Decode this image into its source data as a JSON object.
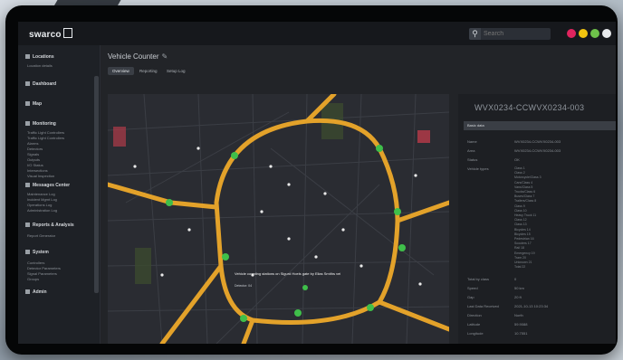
{
  "app": {
    "logo_text": "swarco",
    "search_placeholder": "Search"
  },
  "window_controls": {
    "colors": [
      "#e0245e",
      "#f1c40f",
      "#6ec24a",
      "#e8eaed"
    ]
  },
  "sidebar": {
    "sections": [
      {
        "label": "Locations",
        "items": [
          "Location details"
        ]
      },
      {
        "label": "Dashboard",
        "items": []
      },
      {
        "label": "Map",
        "items": []
      },
      {
        "label": "Monitoring",
        "items": [
          "Traffic Light Controllers",
          "Traffic Light Controllers",
          "Alarms",
          "Detectors",
          "Signals",
          "Outputs",
          "I/O Status",
          "Intersections",
          "Visual Inspection"
        ]
      },
      {
        "label": "Messages Center",
        "items": [
          "Maintenance Log",
          "Incident Mgmt Log",
          "Operations Log",
          "Administration Log"
        ]
      },
      {
        "label": "Reports & Analysis",
        "items": [
          "Report Generator"
        ]
      },
      {
        "label": "System",
        "items": [
          "Controllers",
          "Detector Parameters",
          "Signal Parameters",
          "Groups"
        ]
      },
      {
        "label": "Admin",
        "items": []
      }
    ]
  },
  "main": {
    "title": "Vehicle Counter",
    "tabs": [
      "Overview",
      "Reporting",
      "Setup Log"
    ]
  },
  "map": {
    "popup_title": "Vehicle counting stations on Sigurd Hoels gate by Elias Smiths vei",
    "popup_sub": "Detector: 04"
  },
  "panel": {
    "title": "WVX0234-CCWVX0234-003",
    "section_label": "Basic data",
    "rows": [
      {
        "key": "Name",
        "value": "WVX0234-CCWVX0234-003"
      },
      {
        "key": "Area",
        "value": "WVX0234-CCWVX0234-003"
      },
      {
        "key": "Status",
        "value": "OK"
      },
      {
        "key": "Vehicle types",
        "value": ""
      }
    ],
    "vehicle_types": [
      "Class 1",
      "Class 2",
      "Motorcycle/Class 3",
      "Cars/Class 4",
      "Vans/Class 5",
      "Trucks/Class 6",
      "Buses/Class 7",
      "Trailers/Class 8",
      "Class 9",
      "Class 10",
      "Heavy Truck 11",
      "Class 12",
      "Class 13",
      "Bicycles 14",
      "Bicycles 15",
      "Pedestrian 16",
      "Scooters 17",
      "Rail 18",
      "Emergency 19",
      "Tram 20",
      "Unknown 21",
      "Total 22"
    ],
    "bottom_rows": [
      {
        "key": "Total by class",
        "value": "0"
      },
      {
        "key": "Speed",
        "value": "50 km"
      },
      {
        "key": "Gap",
        "value": "20 ft"
      },
      {
        "key": "Last Data Received",
        "value": "2021-10-13 10:23:34"
      },
      {
        "key": "Direction",
        "value": "North"
      },
      {
        "key": "Latitude",
        "value": "59.9088"
      },
      {
        "key": "Longitude",
        "value": "10.7551"
      }
    ]
  }
}
